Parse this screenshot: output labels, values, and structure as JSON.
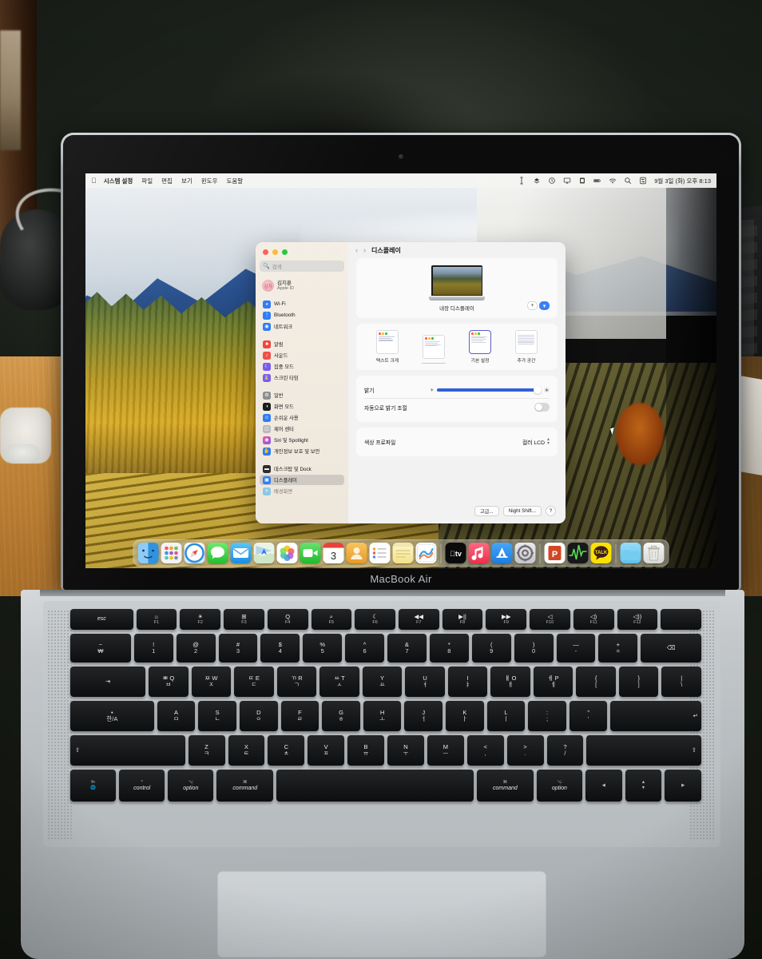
{
  "photo": {
    "device_brand_text": "MacBook Air"
  },
  "menubar": {
    "apple_logo": "apple-logo",
    "items": [
      {
        "label": "시스템 설정",
        "bold": true
      },
      {
        "label": "파일",
        "bold": false
      },
      {
        "label": "편집",
        "bold": false
      },
      {
        "label": "보기",
        "bold": false
      },
      {
        "label": "윈도우",
        "bold": false
      },
      {
        "label": "도움말",
        "bold": false
      }
    ],
    "status_icons": [
      "text-input-icon",
      "dropbox-icon",
      "clock-icon",
      "airplay-icon",
      "battery-case-icon",
      "battery-icon",
      "wifi-icon",
      "search-icon",
      "control-center-icon"
    ],
    "datetime": "9월 3일 (화) 오후 8:13"
  },
  "settings": {
    "window_title": "디스플레이",
    "nav": {
      "back": "‹",
      "forward": "›"
    },
    "search": {
      "placeholder": "검색",
      "value": ""
    },
    "account": {
      "name": "김지훈",
      "subtitle": "Apple ID",
      "initials": "김지"
    },
    "sidebar_groups": [
      {
        "items": [
          {
            "label": "Wi-Fi",
            "icon": "wifi-icon",
            "color": "#2f7cf6"
          },
          {
            "label": "Bluetooth",
            "icon": "bluetooth-icon",
            "color": "#2f7cf6"
          },
          {
            "label": "네트워크",
            "icon": "network-icon",
            "color": "#2f7cf6"
          }
        ]
      },
      {
        "items": [
          {
            "label": "알림",
            "icon": "notifications-icon",
            "color": "#f1453d"
          },
          {
            "label": "사운드",
            "icon": "sound-icon",
            "color": "#f0504a"
          },
          {
            "label": "집중 모드",
            "icon": "focus-moon-icon",
            "color": "#7b5cf0"
          },
          {
            "label": "스크린 타임",
            "icon": "screen-time-icon",
            "color": "#7b5cf0"
          }
        ]
      },
      {
        "items": [
          {
            "label": "일반",
            "icon": "gear-icon",
            "color": "#8e8e93"
          },
          {
            "label": "화면 모드",
            "icon": "appearance-icon",
            "color": "#1c1c1e"
          },
          {
            "label": "손쉬운 사용",
            "icon": "accessibility-icon",
            "color": "#2f7cf6"
          },
          {
            "label": "제어 센터",
            "icon": "control-center-icon",
            "color": "#b9b9be"
          },
          {
            "label": "Siri 및 Spotlight",
            "icon": "siri-icon",
            "color": "#d6468a"
          },
          {
            "label": "개인정보 보호 및 보안",
            "icon": "privacy-hand-icon",
            "color": "#2f7cf6"
          }
        ]
      },
      {
        "items": [
          {
            "label": "데스크탑 및 Dock",
            "icon": "desktop-dock-icon",
            "color": "#2c2c2e"
          },
          {
            "label": "디스플레이",
            "icon": "display-icon",
            "color": "#2f7cf6",
            "selected": true
          },
          {
            "label": "배경화면",
            "icon": "wallpaper-icon",
            "color": "#37b0f0"
          }
        ]
      }
    ],
    "display_card": {
      "display_name": "내장 디스플레이",
      "add_button": "+",
      "dropdown_button": "chevron-down-icon"
    },
    "presets": [
      {
        "label": "텍스트 크게",
        "selected": false,
        "dots": [
          "#ff5f57",
          "#febc2e",
          "#28c840"
        ],
        "style": "large-text"
      },
      {
        "label": "",
        "selected": false,
        "dots": [
          "#ff5f57",
          "#febc2e",
          "#28c840"
        ],
        "style": "medium-text",
        "muted_label": true
      },
      {
        "label": "기본 설정",
        "selected": true,
        "dots": [
          "#ff5f57",
          "#febc2e",
          "#28c840"
        ],
        "style": "default"
      },
      {
        "label": "추가 공간",
        "selected": false,
        "dots": [],
        "style": "more-space"
      }
    ],
    "controls": {
      "brightness": {
        "label": "밝기",
        "value_percent": 94,
        "min_icon": "sun-small-icon",
        "max_icon": "sun-large-icon"
      },
      "auto_brightness": {
        "label": "자동으로 밝기 조절",
        "on": false
      },
      "color_profile": {
        "label": "색상 프로파일",
        "value": "컬러 LCD"
      }
    },
    "footer_buttons": [
      {
        "label": "고급...",
        "name": "advanced-button"
      },
      {
        "label": "Night Shift...",
        "name": "night-shift-button"
      },
      {
        "label": "?",
        "name": "help-button"
      }
    ]
  },
  "dock": {
    "items": [
      {
        "name": "finder",
        "glyph": "☺",
        "bg": "linear-gradient(180deg,#4aa8ef,#1f7fd6)",
        "running": true
      },
      {
        "name": "launchpad",
        "glyph": "⬛",
        "bg": "#f2f2f5",
        "running": false
      },
      {
        "name": "safari",
        "glyph": "🧭",
        "bg": "linear-gradient(180deg,#f8fbff,#cfe6fb)",
        "running": false
      },
      {
        "name": "messages",
        "glyph": "💬",
        "bg": "linear-gradient(180deg,#6ee36a,#22c328)",
        "running": true
      },
      {
        "name": "mail",
        "glyph": "✉",
        "bg": "linear-gradient(180deg,#4fc0f5,#1e8fe0)",
        "running": false
      },
      {
        "name": "maps",
        "glyph": "➤",
        "bg": "linear-gradient(180deg,#eaf5e6,#cfe8c8)",
        "running": false
      },
      {
        "name": "photos",
        "glyph": "❀",
        "bg": "#ffffff",
        "running": false
      },
      {
        "name": "facetime",
        "glyph": "📹",
        "bg": "linear-gradient(180deg,#63e06a,#1fbd2c)",
        "running": false
      },
      {
        "name": "calendar",
        "glyph": "3",
        "bg": "#ffffff",
        "running": false
      },
      {
        "name": "contacts",
        "glyph": "👤",
        "bg": "linear-gradient(180deg,#f7bd53,#e89a2a)",
        "running": false
      },
      {
        "name": "reminders",
        "glyph": "☰",
        "bg": "#ffffff",
        "running": false
      },
      {
        "name": "notes",
        "glyph": "▤",
        "bg": "linear-gradient(180deg,#fdf6c8,#f5e58a)",
        "running": false
      },
      {
        "name": "freeform",
        "glyph": "〰",
        "bg": "#ffffff",
        "running": false
      },
      {
        "name": "appletv",
        "glyph": "tv",
        "bg": "#0b0b0b",
        "running": false
      },
      {
        "name": "music",
        "glyph": "♫",
        "bg": "linear-gradient(180deg,#fb5c74,#f0314c)",
        "running": false
      },
      {
        "name": "appstore",
        "glyph": "A",
        "bg": "linear-gradient(180deg,#3fa0f5,#1f7fe0)",
        "running": false
      },
      {
        "name": "system-settings",
        "glyph": "⚙",
        "bg": "linear-gradient(180deg,#e9e9ec,#c6c6cb)",
        "running": true
      },
      {
        "name": "powerpoint",
        "glyph": "P",
        "bg": "#ffffff",
        "running": true
      },
      {
        "name": "activity-monitor",
        "glyph": "📈",
        "bg": "#16181a",
        "running": true
      },
      {
        "name": "kakaotalk",
        "glyph": "TALK",
        "bg": "#fae100",
        "running": false
      },
      {
        "name": "downloads-folder",
        "glyph": "",
        "bg": "linear-gradient(180deg,#8fd9f5,#63c4ec)",
        "running": false
      },
      {
        "name": "trash",
        "glyph": "🗑",
        "bg": "linear-gradient(180deg,#f4f4f2,#d9dad6)",
        "running": false
      }
    ]
  },
  "keyboard": {
    "fn_row": [
      {
        "main": "esc",
        "sub": "",
        "word": true
      },
      {
        "main": "☼",
        "sub": "F1"
      },
      {
        "main": "☀",
        "sub": "F2"
      },
      {
        "main": "⊞",
        "sub": "F3"
      },
      {
        "main": "Q",
        "sub": "F4"
      },
      {
        "main": "⌕",
        "sub": "F5"
      },
      {
        "main": "☾",
        "sub": "F6"
      },
      {
        "main": "◀◀",
        "sub": "F7"
      },
      {
        "main": "▶||",
        "sub": "F8"
      },
      {
        "main": "▶▶",
        "sub": "F9"
      },
      {
        "main": "◁",
        "sub": "F10"
      },
      {
        "main": "◁)",
        "sub": "F11"
      },
      {
        "main": "◁))",
        "sub": "F12"
      },
      {
        "main": "",
        "sub": ""
      }
    ],
    "num_row": [
      {
        "top": "~",
        "bot": "₩"
      },
      {
        "top": "!",
        "bot": "1"
      },
      {
        "top": "@",
        "bot": "2"
      },
      {
        "top": "#",
        "bot": "3"
      },
      {
        "top": "$",
        "bot": "4"
      },
      {
        "top": "%",
        "bot": "5"
      },
      {
        "top": "^",
        "bot": "6"
      },
      {
        "top": "&",
        "bot": "7"
      },
      {
        "top": "*",
        "bot": "8"
      },
      {
        "top": "(",
        "bot": "9"
      },
      {
        "top": ")",
        "bot": "0"
      },
      {
        "top": "—",
        "bot": "-"
      },
      {
        "top": "+",
        "bot": "="
      },
      {
        "top": "",
        "bot": "⌫"
      }
    ],
    "q_row": [
      {
        "top": "",
        "bot": "⇥"
      },
      {
        "top": "ㅃ Q",
        "bot": "ㅂ"
      },
      {
        "top": "ㅉ W",
        "bot": "ㅈ"
      },
      {
        "top": "ㄸ E",
        "bot": "ㄷ"
      },
      {
        "top": "ㄲ R",
        "bot": "ㄱ"
      },
      {
        "top": "ㅆ T",
        "bot": "ㅅ"
      },
      {
        "top": "Y",
        "bot": "ㅛ"
      },
      {
        "top": "U",
        "bot": "ㅕ"
      },
      {
        "top": "I",
        "bot": "ㅑ"
      },
      {
        "top": "ㅒ O",
        "bot": "ㅐ"
      },
      {
        "top": "ㅖ P",
        "bot": "ㅔ"
      },
      {
        "top": "{",
        "bot": "["
      },
      {
        "top": "}",
        "bot": "]"
      },
      {
        "top": "|",
        "bot": "\\"
      }
    ],
    "a_row": [
      {
        "top": "•",
        "bot": "한/A"
      },
      {
        "top": "A",
        "bot": "ㅁ"
      },
      {
        "top": "S",
        "bot": "ㄴ"
      },
      {
        "top": "D",
        "bot": "ㅇ"
      },
      {
        "top": "F",
        "bot": "ㄹ"
      },
      {
        "top": "G",
        "bot": "ㅎ"
      },
      {
        "top": "H",
        "bot": "ㅗ"
      },
      {
        "top": "J",
        "bot": "ㅓ"
      },
      {
        "top": "K",
        "bot": "ㅏ"
      },
      {
        "top": "L",
        "bot": "ㅣ"
      },
      {
        "top": ":",
        "bot": ";"
      },
      {
        "top": "\"",
        "bot": "'"
      },
      {
        "top": "",
        "bot": "↵"
      }
    ],
    "z_row": [
      {
        "top": "",
        "bot": "⇧"
      },
      {
        "top": "Z",
        "bot": "ㅋ"
      },
      {
        "top": "X",
        "bot": "ㅌ"
      },
      {
        "top": "C",
        "bot": "ㅊ"
      },
      {
        "top": "V",
        "bot": "ㅍ"
      },
      {
        "top": "B",
        "bot": "ㅠ"
      },
      {
        "top": "N",
        "bot": "ㅜ"
      },
      {
        "top": "M",
        "bot": "ㅡ"
      },
      {
        "top": "<",
        "bot": ","
      },
      {
        "top": ">",
        "bot": "."
      },
      {
        "top": "?",
        "bot": "/"
      },
      {
        "top": "",
        "bot": "⇧"
      }
    ],
    "space_row": [
      {
        "top": "fn",
        "bot": "🌐"
      },
      {
        "top": "^",
        "bot": "control"
      },
      {
        "top": "⌥",
        "bot": "option"
      },
      {
        "top": "⌘",
        "bot": "command"
      },
      {
        "top": "",
        "bot": ""
      },
      {
        "top": "⌘",
        "bot": "command"
      },
      {
        "top": "⌥",
        "bot": "option"
      }
    ],
    "arrows": {
      "up": "▲",
      "down": "▼",
      "left": "◀",
      "right": "▶"
    }
  }
}
